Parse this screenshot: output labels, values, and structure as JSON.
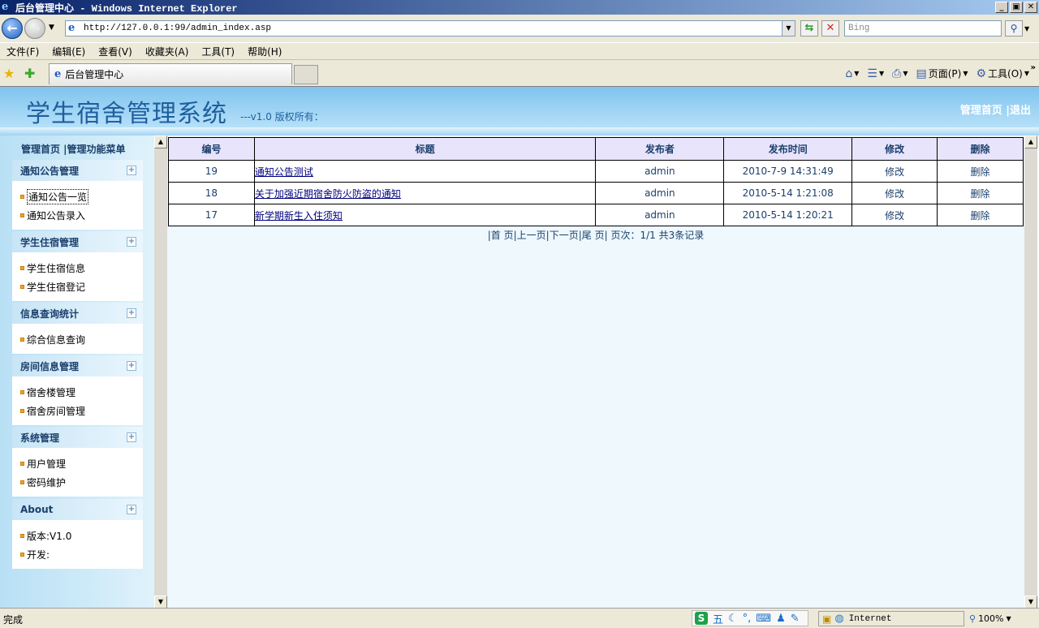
{
  "window": {
    "title": "后台管理中心 - Windows Internet Explorer",
    "buttons": [
      "_",
      "▣",
      "✕"
    ]
  },
  "address": {
    "url": "http://127.0.0.1:99/admin_index.asp",
    "search_placeholder": "Bing"
  },
  "menubar": {
    "items": [
      "文件(F)",
      "编辑(E)",
      "查看(V)",
      "收藏夹(A)",
      "工具(T)",
      "帮助(H)"
    ]
  },
  "tabbar": {
    "tab_label": "后台管理中心",
    "commands": {
      "page": "页面(P)",
      "tools": "工具(O)"
    }
  },
  "header": {
    "system_title": "学生宿舍管理系统",
    "version": "---v1.0 版权所有：",
    "links": "管理首页 |退出"
  },
  "sidebar": {
    "heading": "管理首页 |管理功能菜单",
    "groups": [
      {
        "title": "通知公告管理",
        "items": [
          "通知公告一览",
          "通知公告录入"
        ]
      },
      {
        "title": "学生住宿管理",
        "items": [
          "学生住宿信息",
          "学生住宿登记"
        ]
      },
      {
        "title": "信息查询统计",
        "items": [
          "综合信息查询"
        ]
      },
      {
        "title": "房间信息管理",
        "items": [
          "宿舍楼管理",
          "宿舍房间管理"
        ]
      },
      {
        "title": "系统管理",
        "items": [
          "用户管理",
          "密码维护"
        ]
      },
      {
        "title": "About",
        "items": [
          "版本:V1.0",
          "开发:"
        ]
      }
    ]
  },
  "table": {
    "headers": [
      "编号",
      "标题",
      "发布者",
      "发布时间",
      "修改",
      "删除"
    ],
    "rows": [
      {
        "id": "19",
        "title": "通知公告测试",
        "author": "admin",
        "time": "2010-7-9 14:31:49",
        "edit": "修改",
        "del": "删除"
      },
      {
        "id": "18",
        "title": "关于加强近期宿舍防火防盗的通知",
        "author": "admin",
        "time": "2010-5-14 1:21:08",
        "edit": "修改",
        "del": "删除"
      },
      {
        "id": "17",
        "title": "新学期新生入住须知",
        "author": "admin",
        "time": "2010-5-14 1:20:21",
        "edit": "修改",
        "del": "删除"
      }
    ]
  },
  "pager": {
    "first": "|首 页|",
    "prev": "上一页|",
    "next": "下一页|",
    "last": "尾 页|",
    "info": "页次：1/1 共3条记录"
  },
  "statusbar": {
    "status": "完成",
    "ime_mode": "五",
    "zone": "Internet",
    "zoom": "100%"
  }
}
